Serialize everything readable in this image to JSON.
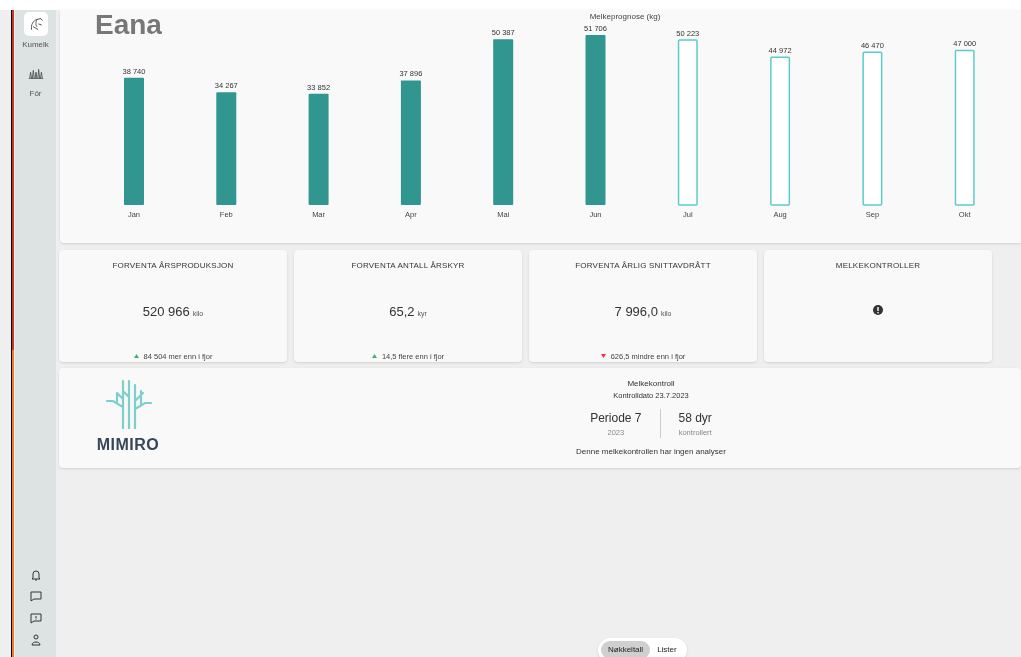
{
  "sidebar": {
    "items": [
      {
        "label": "Kumelk",
        "selected": true
      },
      {
        "label": "Fôr",
        "selected": false
      }
    ]
  },
  "header": {
    "title": "Eana"
  },
  "chart": {
    "chart_data": {
      "type": "bar",
      "title": "Melkeprognose (kg)",
      "categories": [
        "Jan",
        "Feb",
        "Mar",
        "Apr",
        "Mai",
        "Jun",
        "Jul",
        "Aug",
        "Sep",
        "Okt"
      ],
      "data_labels": true,
      "values": [
        38740,
        34267,
        33852,
        37896,
        50387,
        51706,
        50223,
        44972,
        46470,
        47000
      ],
      "value_labels": [
        "38 740",
        "34 267",
        "33 852",
        "37 896",
        "50 387",
        "51 706",
        "50 223",
        "44 972",
        "46 470",
        "47 000"
      ]
    },
    "bars": [
      {
        "forecast": false
      },
      {
        "forecast": false
      },
      {
        "forecast": false
      },
      {
        "forecast": false
      },
      {
        "forecast": false
      },
      {
        "forecast": false
      },
      {
        "forecast": true
      },
      {
        "forecast": true
      },
      {
        "forecast": true
      },
      {
        "forecast": true
      }
    ]
  },
  "kpis": [
    {
      "kind": "value",
      "title": "FORVENTA ÅRSPRODUKSJON",
      "value": "520 966",
      "unit": "kilo",
      "increase": true,
      "change": "84 504 mer enn i fjor"
    },
    {
      "kind": "value",
      "title": "FORVENTA ANTALL ÅRSKYR",
      "value": "65,2",
      "unit": "kyr",
      "increase": true,
      "change": "14,5 flere enn i fjor"
    },
    {
      "kind": "value",
      "title": "FORVENTA ÅRLIG SNITTAVDRÅTT",
      "value": "7 996,0",
      "unit": "kilo",
      "increase": false,
      "change": "626,5 mindre enn i fjor"
    },
    {
      "kind": "alert",
      "title": "MELKEKONTROLLER"
    }
  ],
  "milk_control": {
    "logo_text": "MIMIRO",
    "title": "Melkekontroll",
    "date": "Kontrolldato 23.7.2023",
    "period": "Periode 7",
    "year": "2023",
    "animals": "58 dyr",
    "animals_note": "kontrollert",
    "note": "Denne melkekontrollen har ingen analyser"
  },
  "view_toggle": [
    {
      "label": "Nøkkeltall",
      "selected": true
    },
    {
      "label": "Lister",
      "selected": false
    }
  ]
}
